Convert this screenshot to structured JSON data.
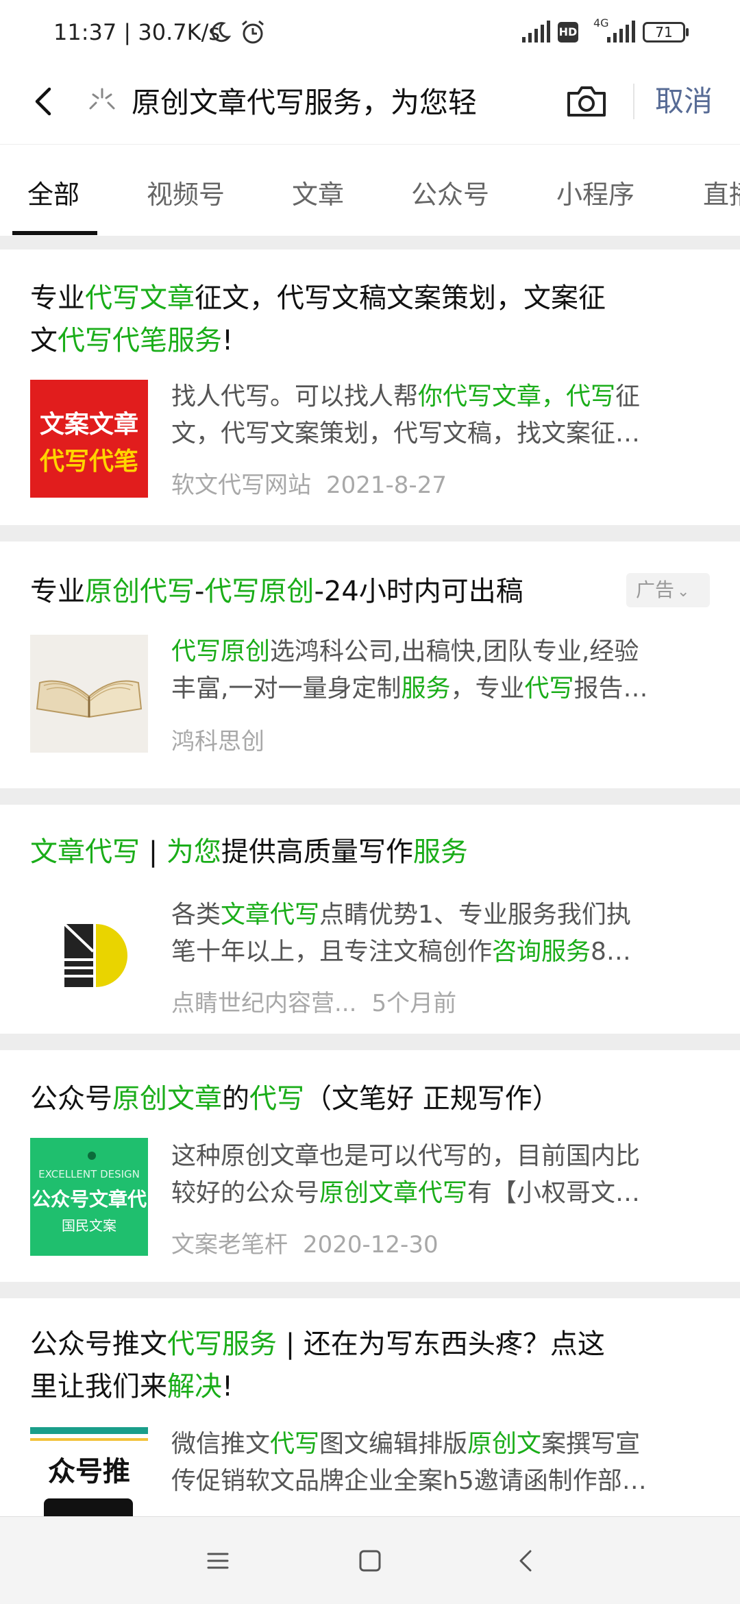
{
  "status_bar": {
    "time": "11:37 | 30.7K/s",
    "hd_label": "HD",
    "network_label": "4G",
    "battery": "71"
  },
  "search": {
    "query": "原创文章代写服务，为您轻",
    "cancel_label": "取消"
  },
  "tabs": [
    {
      "label": "全部",
      "active": true
    },
    {
      "label": "视频号"
    },
    {
      "label": "文章"
    },
    {
      "label": "公众号"
    },
    {
      "label": "小程序"
    },
    {
      "label": "直播"
    }
  ],
  "results": [
    {
      "title_parts": [
        "专业",
        "代写文章",
        "征文，代写文稿文案策划，文案征\n文",
        "代写代笔服务",
        "!"
      ],
      "thumb_text": [
        "文案文章",
        "代写代笔"
      ],
      "snippet_line1": [
        "找人代写。可以找人帮",
        "你代写文章，代写",
        "征"
      ],
      "snippet_line2": [
        "文，代写文案策划，代写文稿，找文案征…"
      ],
      "source": "软文代写网站",
      "date": "2021-8-27"
    },
    {
      "title_parts": [
        "专业",
        "原创代写",
        "-",
        "代写原创",
        "-24小时内可出稿"
      ],
      "ad_label": "广告",
      "snippet_line1": [
        "代写原创",
        "选鸿科公司,出稿快,团队专业,经验"
      ],
      "snippet_line2": [
        "丰富,一对一量身定制",
        "服务",
        "，专业",
        "代写",
        "报告…"
      ],
      "source": "鸿科思创"
    },
    {
      "title_parts": [
        "文章代写",
        " | ",
        "为您",
        "提供高质量写作",
        "服务"
      ],
      "snippet_line1": [
        "各类",
        "文章代写",
        "点睛优势1、专业服务我们执"
      ],
      "snippet_line2": [
        "笔十年以上，且专注文稿创作",
        "咨询服务",
        "8…"
      ],
      "source": "点睛世纪内容营...",
      "date": "5个月前"
    },
    {
      "title_parts": [
        "公众号",
        "原创文章",
        "的",
        "代写",
        "（文笔好 正规写作）"
      ],
      "thumb_text": [
        "EXCELLENT DESIGN",
        "公众号文章代",
        "国民文案"
      ],
      "snippet_line1": [
        "这种原创文章也是可以代写的，目前国内比"
      ],
      "snippet_line2": [
        "较好的公众号",
        "原创文章代写",
        "有【小权哥文…"
      ],
      "source": "文案老笔杆",
      "date": "2020-12-30"
    },
    {
      "title_parts": [
        "公众号推文",
        "代写服务",
        " | 还在为写东西头疼？点这\n里让我们来",
        "解决",
        "!"
      ],
      "thumb_text": [
        "众号推"
      ],
      "snippet_line1": [
        "微信推文",
        "代写",
        "图文编辑排版",
        "原创文",
        "案撰写宣"
      ],
      "snippet_line2": [
        "传促销软文品牌企业全案h5邀请函制作部…"
      ]
    }
  ],
  "colors": {
    "highlight": "#1aad19",
    "link_blue": "#576b95",
    "background": "#ededed"
  }
}
